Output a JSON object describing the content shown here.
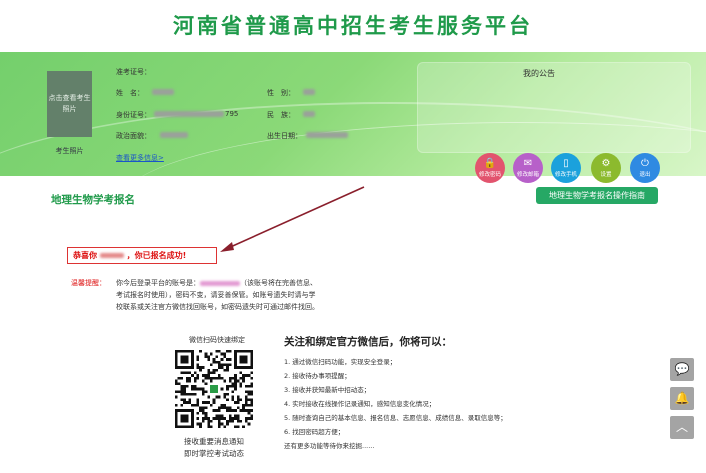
{
  "site_title": "河南省普通高中招生考生服务平台",
  "profile": {
    "photo_placeholder": "点击查看考生照片",
    "photo_caption": "考生照片",
    "exam_no_label": "准考证号：",
    "name_label": "姓　名：",
    "gender_label": "性　别：",
    "id_label": "身份证号：",
    "id_visible_suffix": "795",
    "ethnicity_label": "民　族：",
    "political_label": "政治面貌：",
    "birth_label": "出生日期：",
    "more_info_link": "查看更多信息>"
  },
  "notice": {
    "title": "我的公告"
  },
  "actions": [
    {
      "label": "修改密码",
      "icon": "lock-icon",
      "glyph": "🔒",
      "color": "#e2546e"
    },
    {
      "label": "修改邮箱",
      "icon": "mail-icon",
      "glyph": "✉",
      "color": "#b760c9"
    },
    {
      "label": "修改手机",
      "icon": "phone-icon",
      "glyph": "▯",
      "color": "#1ba1dc"
    },
    {
      "label": "设置",
      "icon": "gear-icon",
      "glyph": "⚙",
      "color": "#8cba2e"
    },
    {
      "label": "退出",
      "icon": "power-icon",
      "glyph": "⏻",
      "color": "#2f8ae2"
    }
  ],
  "guide_button": "地理生物学考报名操作指南",
  "section_title": "地理生物学考报名",
  "success": {
    "prefix": "恭喜你",
    "suffix": "，你已报名成功!"
  },
  "tip": {
    "label": "温馨提醒：",
    "line1_a": "你今后登录平台的账号是：",
    "line1_b": "（该账号将在完善信息、",
    "line2": "考试报名时使用），密码不变，请妥善保管。如账号遗失时请与学",
    "line3": "校联系或关注官方微信找回账号，如密码遗失时可通过邮件找回。"
  },
  "wechat": {
    "qr_caption": "微信扫码快速绑定",
    "qr_bottom_line1": "接收重要消息通知",
    "qr_bottom_line2": "即时掌控考试动态",
    "bind_title": "关注和绑定官方微信后，你将可以：",
    "items": [
      "1. 通过微信扫码功能，实现安全登录；",
      "2. 接收待办事项提醒；",
      "3. 接收并获知最新中招动态；",
      "4. 实时接收在线操作记录通知，感知信息变化情况；",
      "5. 随时查询自己的基本信息、报名信息、志愿信息、成绩信息、录取信息等；",
      "6. 找回密码超方便；",
      "还有更多功能等待你来挖掘......"
    ]
  },
  "sidebar_tools": [
    {
      "icon": "wechat-icon",
      "glyph": "💬"
    },
    {
      "icon": "qq-icon",
      "glyph": "🔔"
    },
    {
      "icon": "back-to-top-icon",
      "glyph": "︿"
    }
  ],
  "colors": {
    "brand_green": "#1f9a4a",
    "alert_red": "#d11111",
    "link_blue": "#1a55c9"
  }
}
